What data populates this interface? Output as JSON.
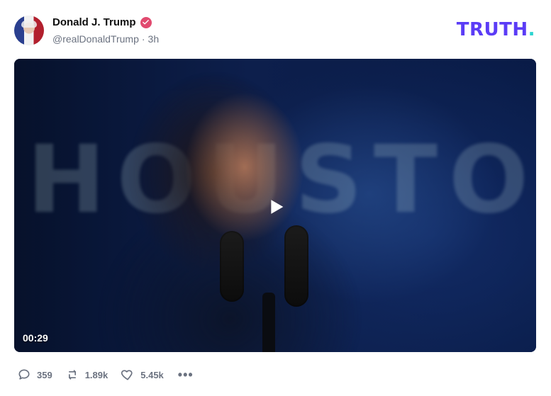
{
  "post": {
    "author": {
      "display_name": "Donald J. Trump",
      "handle": "@realDonaldTrump",
      "time_ago": "3h",
      "verified_icon": "verified-badge-icon"
    },
    "brand": {
      "logo_text": "TRUTH",
      "logo_dot": "."
    },
    "media": {
      "type": "video",
      "duration": "00:29",
      "play_icon": "play-icon"
    },
    "actions": {
      "reply": {
        "icon": "reply-icon",
        "count": "359"
      },
      "retruth": {
        "icon": "retruth-icon",
        "count": "1.89k"
      },
      "like": {
        "icon": "heart-icon",
        "count": "5.45k"
      },
      "more": {
        "icon": "more-icon",
        "label": "•••"
      }
    }
  },
  "colors": {
    "brand_purple": "#5b3cf6",
    "brand_teal": "#2bd4d0",
    "muted_text": "#6b7280",
    "verified_pink": "#e14a6f"
  }
}
